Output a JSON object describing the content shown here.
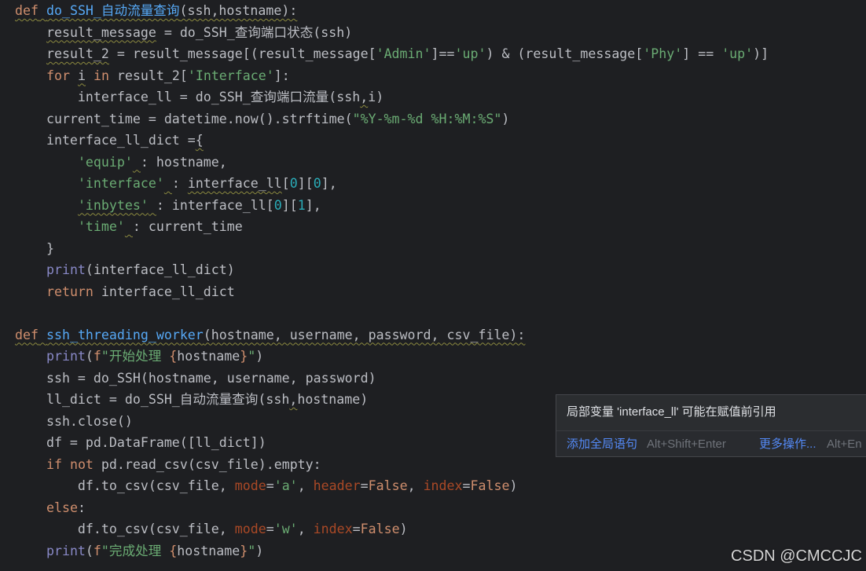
{
  "editor": {
    "theme": {
      "p": "#bcbec4",
      "kw": "#cf8e6d",
      "fn": "#56a8f5",
      "s": "#6aab73",
      "n": "#2aacb8",
      "b": "#8888c6",
      "pa": "#aa4926",
      "warn": "#8c8a3f"
    },
    "lines": [
      {
        "warn": true,
        "tokens": [
          {
            "kw": "def"
          },
          {
            "p": " "
          },
          {
            "fn": "do_SSH_自动流量查询"
          },
          {
            "p": "(ssh,hostname):"
          }
        ]
      },
      {
        "tokens": [
          {
            "p": "    "
          },
          {
            "p": "result_message",
            "warn": true
          },
          {
            "p": " = do_SSH_查询端口状态(ssh)"
          }
        ]
      },
      {
        "tokens": [
          {
            "p": "    "
          },
          {
            "p": "result_2",
            "warn": true
          },
          {
            "p": " = result_message[(result_message["
          },
          {
            "s": "'Admin'"
          },
          {
            "p": "]=="
          },
          {
            "s": "'up'"
          },
          {
            "p": ") & (result_message["
          },
          {
            "s": "'Phy'"
          },
          {
            "p": "] == "
          },
          {
            "s": "'up'"
          },
          {
            "p": ")]"
          }
        ]
      },
      {
        "tokens": [
          {
            "p": "    "
          },
          {
            "kw": "for"
          },
          {
            "p": " "
          },
          {
            "p": "i",
            "warn": true
          },
          {
            "p": " "
          },
          {
            "kw": "in"
          },
          {
            "p": " result_2["
          },
          {
            "s": "'Interface'"
          },
          {
            "p": "]:"
          }
        ]
      },
      {
        "tokens": [
          {
            "p": "        interface_ll = do_SSH_查询端口流量(ssh"
          },
          {
            "p": ",",
            "warn": true
          },
          {
            "p": "i)"
          }
        ]
      },
      {
        "tokens": [
          {
            "p": "    current_time = datetime.now().strftime("
          },
          {
            "s": "\"%Y-%m-%d %H:%M:%S\""
          },
          {
            "p": ")"
          }
        ]
      },
      {
        "tokens": [
          {
            "p": "    interface_ll_dict ="
          },
          {
            "p": "{",
            "warn": true
          }
        ]
      },
      {
        "tokens": [
          {
            "p": "        "
          },
          {
            "s": "'equip'"
          },
          {
            "p": " ",
            "warn": true
          },
          {
            "p": ": hostname,"
          }
        ]
      },
      {
        "tokens": [
          {
            "p": "        "
          },
          {
            "s": "'interface'"
          },
          {
            "p": " ",
            "warn": true
          },
          {
            "p": ": "
          },
          {
            "p": "interface_ll",
            "warn": true
          },
          {
            "p": "["
          },
          {
            "n": "0"
          },
          {
            "p": "]["
          },
          {
            "n": "0"
          },
          {
            "p": "],"
          }
        ]
      },
      {
        "tokens": [
          {
            "p": "        "
          },
          {
            "s": "'inbytes'",
            "warn": true
          },
          {
            "p": " ",
            "warn": true
          },
          {
            "p": ": interface_ll["
          },
          {
            "n": "0"
          },
          {
            "p": "]["
          },
          {
            "n": "1"
          },
          {
            "p": "],"
          }
        ]
      },
      {
        "tokens": [
          {
            "p": "        "
          },
          {
            "s": "'time'"
          },
          {
            "p": " ",
            "warn": true
          },
          {
            "p": ": current_time"
          }
        ]
      },
      {
        "tokens": [
          {
            "p": "    }"
          }
        ]
      },
      {
        "tokens": [
          {
            "p": "    "
          },
          {
            "b": "print"
          },
          {
            "p": "(interface_ll_dict)"
          }
        ]
      },
      {
        "tokens": [
          {
            "p": "    "
          },
          {
            "kw": "return"
          },
          {
            "p": " interface_ll_dict"
          }
        ]
      },
      {
        "tokens": []
      },
      {
        "warn": true,
        "tokens": [
          {
            "kw": "def"
          },
          {
            "p": " "
          },
          {
            "fn": "ssh_threading_worker"
          },
          {
            "p": "(hostname, username, password, csv_file):"
          }
        ]
      },
      {
        "tokens": [
          {
            "p": "    "
          },
          {
            "b": "print"
          },
          {
            "p": "("
          },
          {
            "kw": "f"
          },
          {
            "s": "\"开始处理 "
          },
          {
            "kw": "{"
          },
          {
            "p": "hostname"
          },
          {
            "kw": "}"
          },
          {
            "s": "\""
          },
          {
            "p": ")"
          }
        ]
      },
      {
        "tokens": [
          {
            "p": "    ssh = do_SSH(hostname, username, password)"
          }
        ]
      },
      {
        "tokens": [
          {
            "p": "    ll_dict = do_SSH_自动流量查询(ssh"
          },
          {
            "p": ",",
            "warn": true
          },
          {
            "p": "hostname)"
          }
        ]
      },
      {
        "tokens": [
          {
            "p": "    ssh.close()"
          }
        ]
      },
      {
        "tokens": [
          {
            "p": "    df = pd.DataFrame([ll_dict])"
          }
        ]
      },
      {
        "tokens": [
          {
            "p": "    "
          },
          {
            "kw": "if"
          },
          {
            "p": " "
          },
          {
            "kw": "not"
          },
          {
            "p": " pd.read_csv(csv_file).empty:"
          }
        ]
      },
      {
        "tokens": [
          {
            "p": "        df.to_csv(csv_file, "
          },
          {
            "pa": "mode"
          },
          {
            "p": "="
          },
          {
            "s": "'a'"
          },
          {
            "p": ", "
          },
          {
            "pa": "header"
          },
          {
            "p": "="
          },
          {
            "kw": "False"
          },
          {
            "p": ", "
          },
          {
            "pa": "index"
          },
          {
            "p": "="
          },
          {
            "kw": "False"
          },
          {
            "p": ")"
          }
        ]
      },
      {
        "tokens": [
          {
            "p": "    "
          },
          {
            "kw": "else"
          },
          {
            "p": ":"
          }
        ]
      },
      {
        "tokens": [
          {
            "p": "        df.to_csv(csv_file, "
          },
          {
            "pa": "mode"
          },
          {
            "p": "="
          },
          {
            "s": "'w'"
          },
          {
            "p": ", "
          },
          {
            "pa": "index"
          },
          {
            "p": "="
          },
          {
            "kw": "False"
          },
          {
            "p": ")"
          }
        ]
      },
      {
        "tokens": [
          {
            "p": "    "
          },
          {
            "b": "print"
          },
          {
            "p": "("
          },
          {
            "kw": "f"
          },
          {
            "s": "\"完成处理 "
          },
          {
            "kw": "{"
          },
          {
            "p": "hostname"
          },
          {
            "kw": "}"
          },
          {
            "s": "\""
          },
          {
            "p": ")"
          }
        ]
      }
    ]
  },
  "inspection_popup": {
    "message": "局部变量 'interface_ll' 可能在赋值前引用",
    "actions": [
      {
        "label": "添加全局语句",
        "shortcut": "Alt+Shift+Enter"
      },
      {
        "label": "更多操作...",
        "shortcut": "Alt+En"
      }
    ]
  },
  "watermark": "CSDN @CMCCJC"
}
